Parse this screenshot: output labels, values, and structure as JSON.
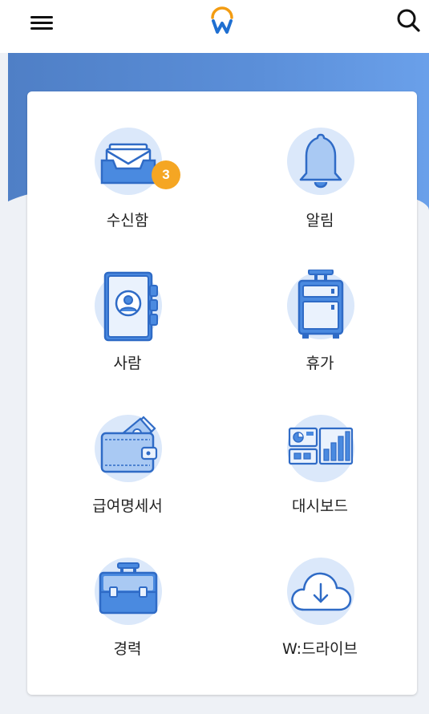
{
  "header": {
    "menu_icon": "hamburger-menu-icon",
    "logo_icon": "workday-w-logo",
    "search_icon": "search-icon"
  },
  "colors": {
    "accent": "#4f7fc6",
    "icon_bg": "#dbe8fa",
    "icon_line": "#2f6bc6",
    "badge": "#f5a623"
  },
  "apps": [
    {
      "label": "수신함",
      "icon": "inbox-tray-icon",
      "badge": "3"
    },
    {
      "label": "알림",
      "icon": "bell-icon"
    },
    {
      "label": "사람",
      "icon": "address-book-icon"
    },
    {
      "label": "휴가",
      "icon": "suitcase-trolley-icon"
    },
    {
      "label": "급여명세서",
      "icon": "wallet-icon"
    },
    {
      "label": "대시보드",
      "icon": "dashboard-chart-icon"
    },
    {
      "label": "경력",
      "icon": "briefcase-icon"
    },
    {
      "label": "W:드라이브",
      "icon": "cloud-download-icon"
    }
  ]
}
